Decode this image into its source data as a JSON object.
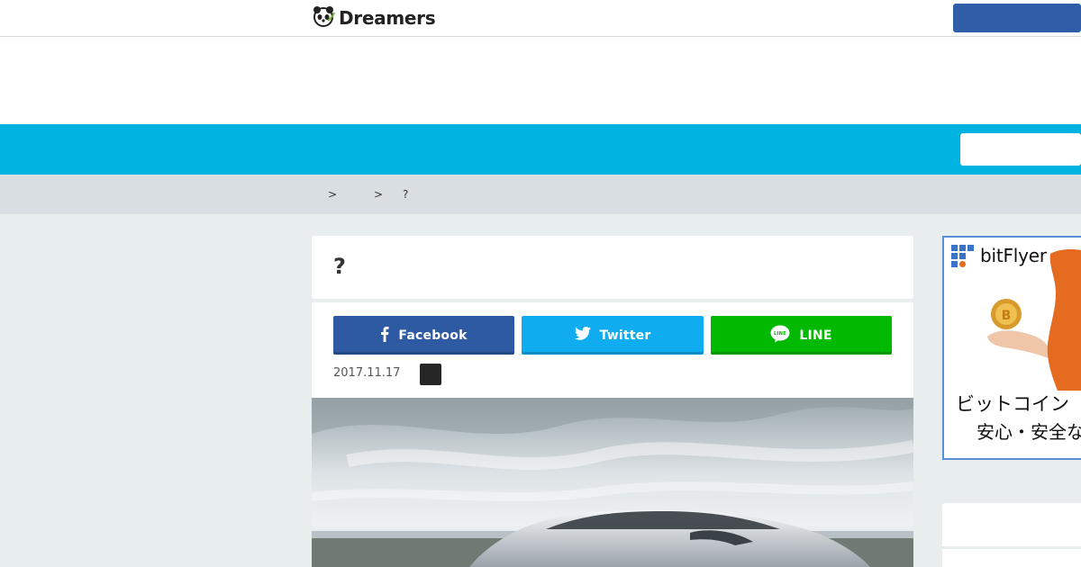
{
  "site": {
    "logo_text": "Dreamers"
  },
  "breadcrumb": {
    "separators": [
      ">",
      ">"
    ],
    "current": "?"
  },
  "article": {
    "title": "?",
    "date": "2017.11.17"
  },
  "share": {
    "facebook_label": "Facebook",
    "twitter_label": "Twitter",
    "line_label": "LINE",
    "line_icon_text": "LINE"
  },
  "sidebar_ad": {
    "brand": "bitFlyer",
    "tagline_line1": "ビットコイン",
    "tagline_line2": "安心・安全な"
  },
  "colors": {
    "header_band": "#00b3e0",
    "facebook": "#2e5aa3",
    "twitter": "#10acf0",
    "line": "#00b900",
    "top_button": "#2f5da7",
    "ad_border": "#5a8fd8"
  },
  "icons": {
    "logo": "panda-icon",
    "facebook": "facebook-icon",
    "twitter": "twitter-icon",
    "line": "line-icon",
    "brand": "bitflyer-logo-icon"
  }
}
